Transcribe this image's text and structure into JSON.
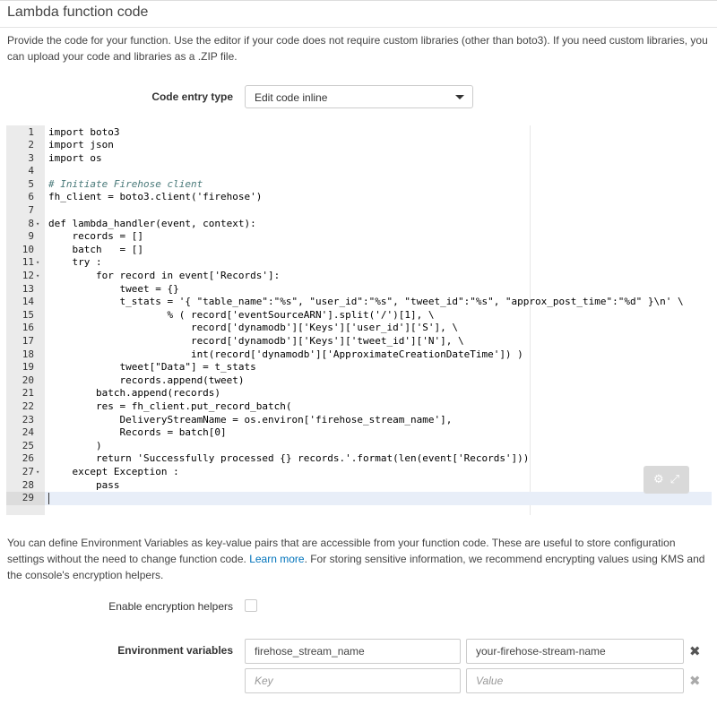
{
  "section": {
    "title": "Lambda function code",
    "description": "Provide the code for your function. Use the editor if your code does not require custom libraries (other than boto3). If you need custom libraries, you can upload your code and libraries as a .ZIP file."
  },
  "code_entry": {
    "label": "Code entry type",
    "selected": "Edit code inline"
  },
  "editor": {
    "lines": [
      {
        "n": "1",
        "text": "import boto3",
        "fold": ""
      },
      {
        "n": "2",
        "text": "import json",
        "fold": ""
      },
      {
        "n": "3",
        "text": "import os",
        "fold": ""
      },
      {
        "n": "4",
        "text": "",
        "fold": ""
      },
      {
        "n": "5",
        "text": "# Initiate Firehose client",
        "fold": "",
        "comment": true
      },
      {
        "n": "6",
        "text": "fh_client = boto3.client('firehose')",
        "fold": ""
      },
      {
        "n": "7",
        "text": "",
        "fold": ""
      },
      {
        "n": "8",
        "text": "def lambda_handler(event, context):",
        "fold": "▾"
      },
      {
        "n": "9",
        "text": "    records = []",
        "fold": ""
      },
      {
        "n": "10",
        "text": "    batch   = []",
        "fold": ""
      },
      {
        "n": "11",
        "text": "    try :",
        "fold": "▾"
      },
      {
        "n": "12",
        "text": "        for record in event['Records']:",
        "fold": "▾"
      },
      {
        "n": "13",
        "text": "            tweet = {}",
        "fold": ""
      },
      {
        "n": "14",
        "text": "            t_stats = '{ \"table_name\":\"%s\", \"user_id\":\"%s\", \"tweet_id\":\"%s\", \"approx_post_time\":\"%d\" }\\n' \\",
        "fold": ""
      },
      {
        "n": "15",
        "text": "                    % ( record['eventSourceARN'].split('/')[1], \\",
        "fold": ""
      },
      {
        "n": "16",
        "text": "                        record['dynamodb']['Keys']['user_id']['S'], \\",
        "fold": ""
      },
      {
        "n": "17",
        "text": "                        record['dynamodb']['Keys']['tweet_id']['N'], \\",
        "fold": ""
      },
      {
        "n": "18",
        "text": "                        int(record['dynamodb']['ApproximateCreationDateTime']) )",
        "fold": ""
      },
      {
        "n": "19",
        "text": "            tweet[\"Data\"] = t_stats",
        "fold": ""
      },
      {
        "n": "20",
        "text": "            records.append(tweet)",
        "fold": ""
      },
      {
        "n": "21",
        "text": "        batch.append(records)",
        "fold": ""
      },
      {
        "n": "22",
        "text": "        res = fh_client.put_record_batch(",
        "fold": ""
      },
      {
        "n": "23",
        "text": "            DeliveryStreamName = os.environ['firehose_stream_name'],",
        "fold": ""
      },
      {
        "n": "24",
        "text": "            Records = batch[0]",
        "fold": ""
      },
      {
        "n": "25",
        "text": "        )",
        "fold": ""
      },
      {
        "n": "26",
        "text": "        return 'Successfully processed {} records.'.format(len(event['Records']))",
        "fold": ""
      },
      {
        "n": "27",
        "text": "    except Exception :",
        "fold": "▾"
      },
      {
        "n": "28",
        "text": "        pass",
        "fold": ""
      },
      {
        "n": "29",
        "text": "",
        "fold": "",
        "active": true
      }
    ],
    "tools_icons": [
      "gear-icon",
      "expand-icon"
    ]
  },
  "env": {
    "description_before_link": "You can define Environment Variables as key-value pairs that are accessible from your function code. These are useful to store configuration settings without the need to change function code. ",
    "link_text": "Learn more",
    "description_after_link": ". For storing sensitive information, we recommend encrypting values using KMS and the console's encryption helpers.",
    "encryption_label": "Enable encryption helpers",
    "variables_label": "Environment variables",
    "rows": [
      {
        "key": "firehose_stream_name",
        "value": "your-firehose-stream-name"
      },
      {
        "key": "",
        "value": ""
      }
    ],
    "key_placeholder": "Key",
    "value_placeholder": "Value",
    "remove_glyph": "✖"
  }
}
